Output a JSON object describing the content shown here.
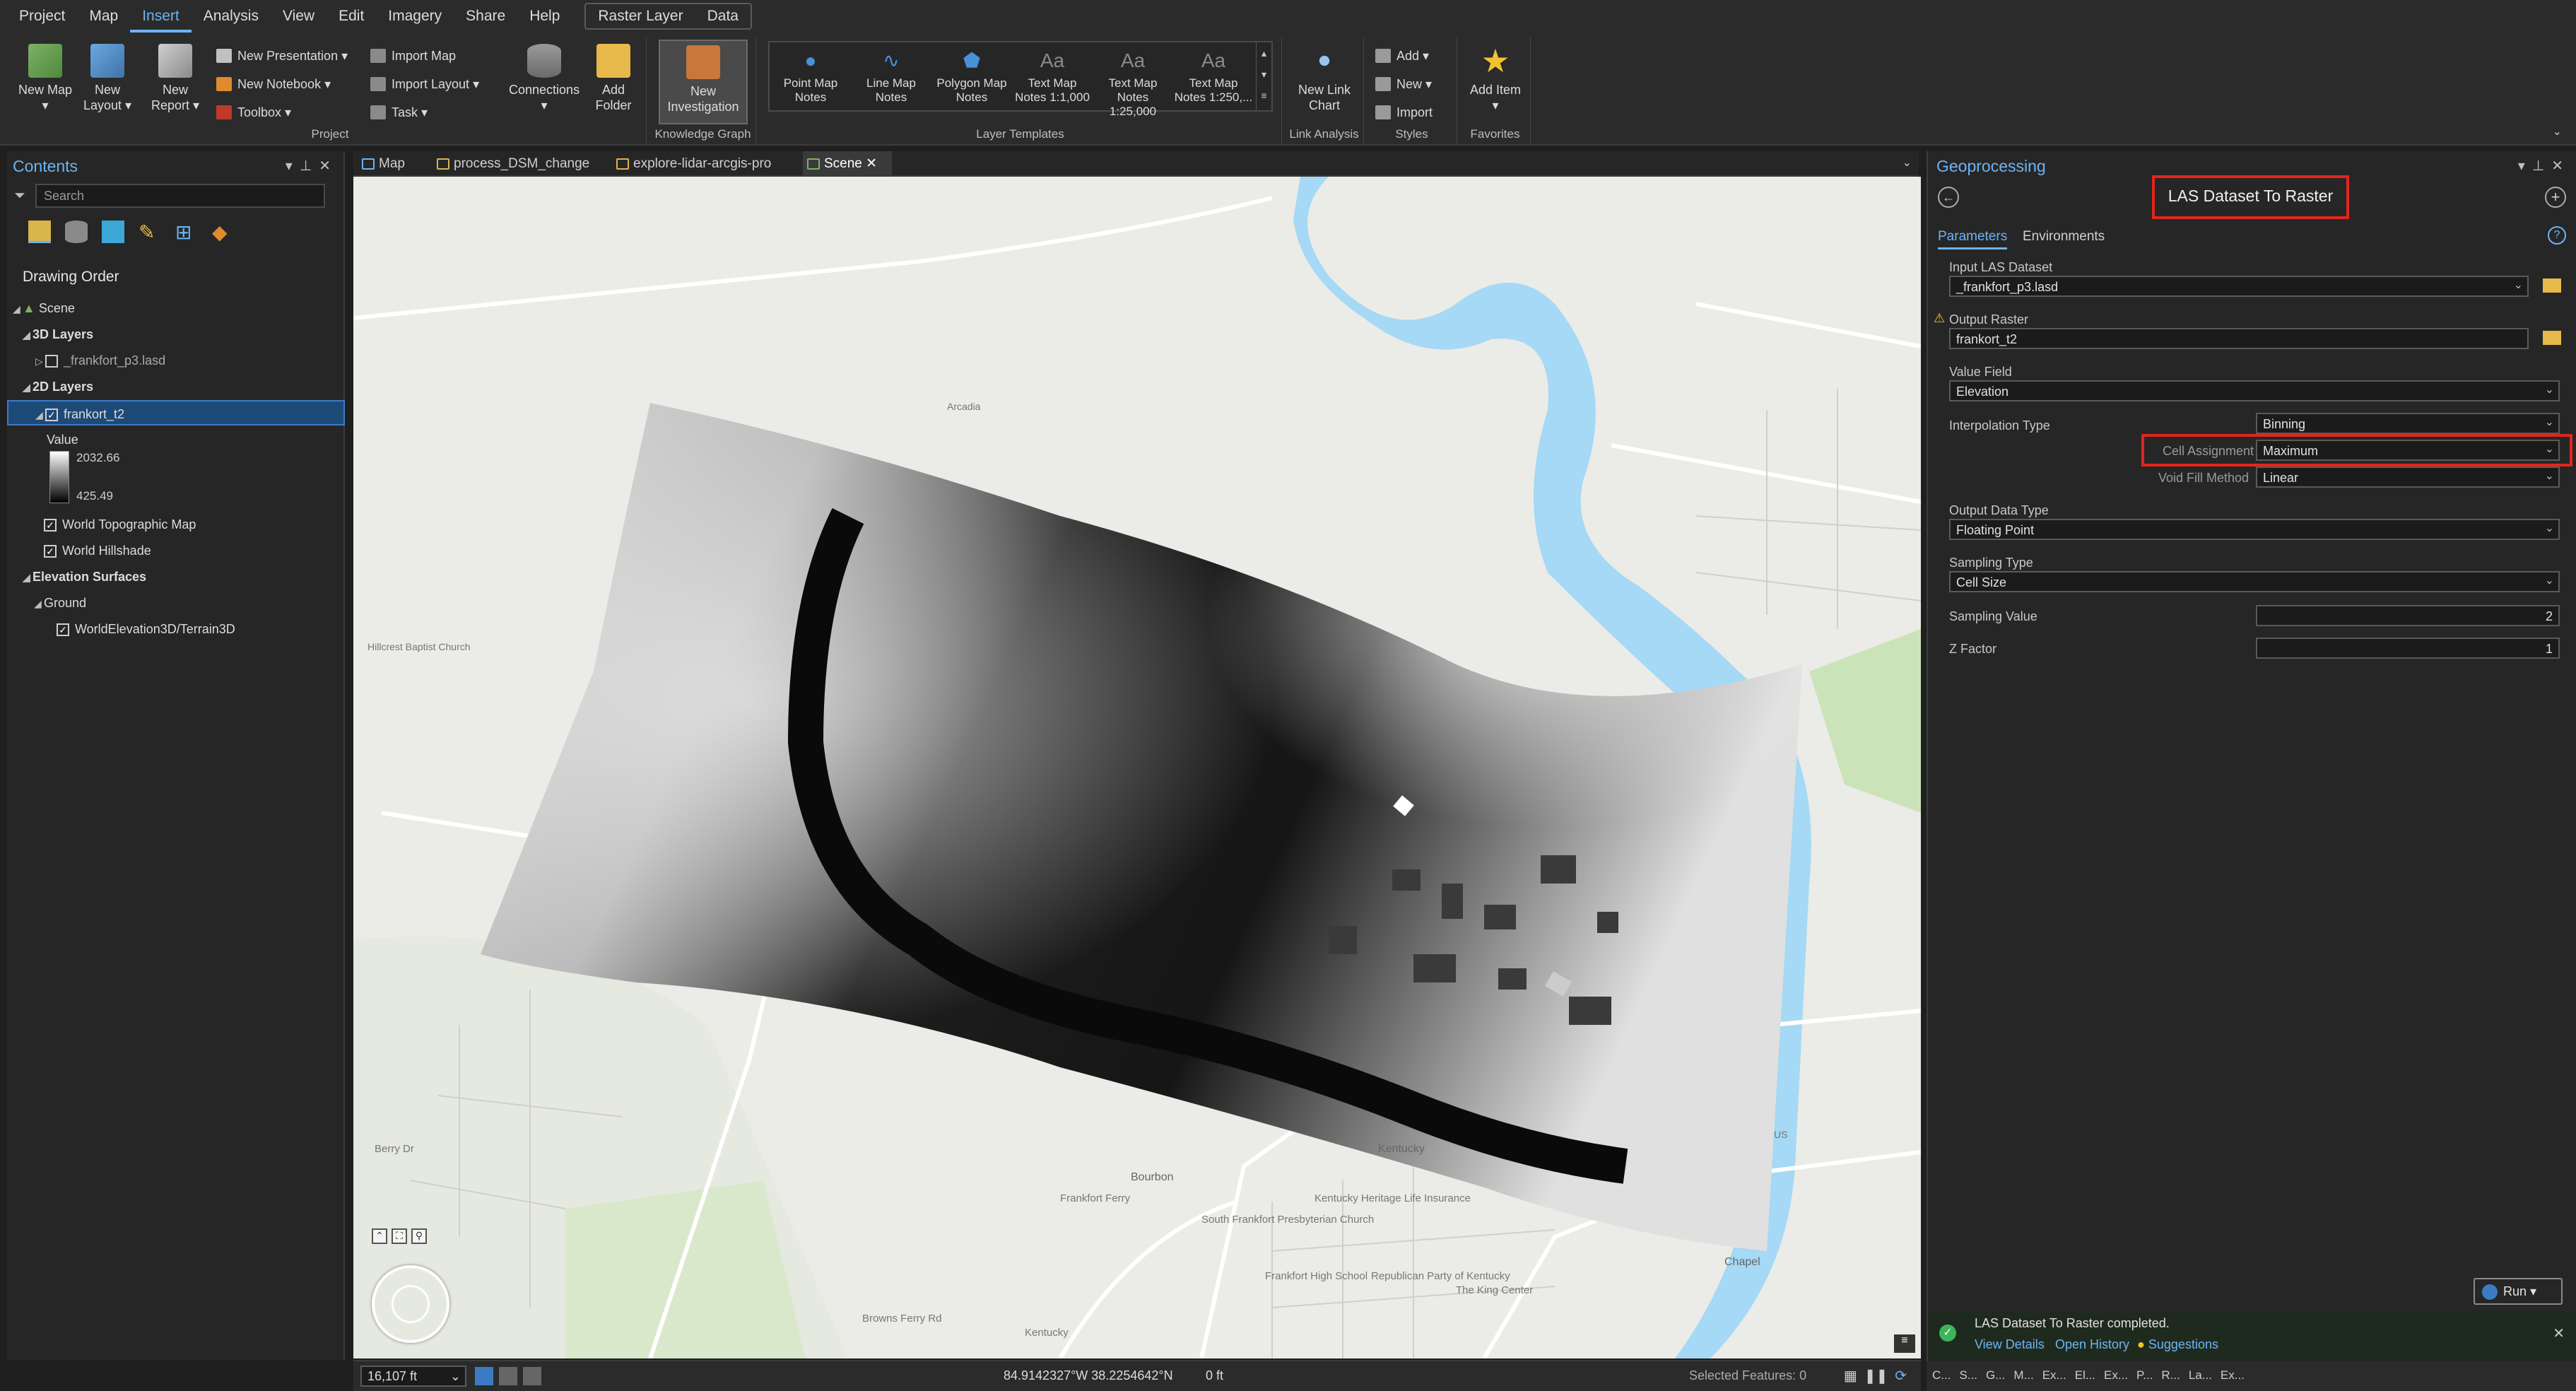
{
  "menubar": {
    "items": [
      "Project",
      "Map",
      "Insert",
      "Analysis",
      "View",
      "Edit",
      "Imagery",
      "Share",
      "Help"
    ],
    "active": "Insert",
    "contextual": [
      "Raster Layer",
      "Data"
    ]
  },
  "ribbon": {
    "project": {
      "label": "Project",
      "new_map": "New Map",
      "new_layout": "New Layout",
      "new_report": "New Report",
      "new_presentation": "New Presentation",
      "new_notebook": "New Notebook",
      "toolbox": "Toolbox",
      "import_map": "Import Map",
      "import_layout": "Import Layout",
      "task": "Task",
      "connections": "Connections",
      "add_folder": "Add Folder"
    },
    "knowledge_graph": {
      "label": "Knowledge Graph",
      "new_investigation": "New Investigation"
    },
    "layer_templates": {
      "label": "Layer Templates",
      "items": [
        "Point Map Notes",
        "Line Map Notes",
        "Polygon Map Notes",
        "Text Map Notes 1:1,000",
        "Text Map Notes 1:25,000",
        "Text Map Notes 1:250,..."
      ]
    },
    "link_analysis": {
      "label": "Link Analysis",
      "new_link_chart": "New Link Chart"
    },
    "styles": {
      "label": "Styles",
      "add": "Add",
      "new": "New",
      "import": "Import"
    },
    "favorites": {
      "label": "Favorites",
      "add_item": "Add Item"
    }
  },
  "contents": {
    "title": "Contents",
    "search_placeholder": "Search",
    "drawing_order": "Drawing Order",
    "tree": {
      "scene": "Scene",
      "layers3d": "3D Layers",
      "lasd": "_frankfort_p3.lasd",
      "layers2d": "2D Layers",
      "frankort_t2": "frankort_t2",
      "value_label": "Value",
      "value_high": "2032.66",
      "value_low": "425.49",
      "topo": "World Topographic Map",
      "hillshade": "World Hillshade",
      "elev_surfaces": "Elevation Surfaces",
      "ground": "Ground",
      "terrain": "WorldElevation3D/Terrain3D"
    }
  },
  "view_tabs": [
    "Map",
    "process_DSM_change",
    "explore-lidar-arcgis-pro",
    "Scene"
  ],
  "map_labels": {
    "l1": "Bourbon",
    "l2": "Kentucky",
    "l3": "Frankfort High School",
    "l4": "South Frankfort Presbyterian Church",
    "l5": "Kentucky Heritage Life Insurance",
    "l6": "Republican Party of Kentucky",
    "l7": "The King Center",
    "l8": "Chapel",
    "l9": "Berry Dr",
    "l10": "Browns Ferry Rd",
    "l11": "Frankfort Ferry",
    "l12": "Hillcrest Baptist Church",
    "l13": "Kentucky",
    "l14": "Arcadia",
    "l15": "US"
  },
  "statusbar": {
    "scale": "16,107 ft",
    "coords": "84.9142327°W 38.2254642°N",
    "elevation": "0 ft",
    "selected": "Selected Features: 0"
  },
  "geoprocessing": {
    "title": "Geoprocessing",
    "tool_name": "LAS Dataset To Raster",
    "tab_parameters": "Parameters",
    "tab_environments": "Environments",
    "params": {
      "input_las_label": "Input LAS Dataset",
      "input_las_value": "_frankfort_p3.lasd",
      "output_raster_label": "Output Raster",
      "output_raster_value": "frankort_t2",
      "value_field_label": "Value Field",
      "value_field_value": "Elevation",
      "interp_label": "Interpolation Type",
      "interp_value": "Binning",
      "cell_assign_label": "Cell Assignment",
      "cell_assign_value": "Maximum",
      "void_fill_label": "Void Fill Method",
      "void_fill_value": "Linear",
      "output_type_label": "Output Data Type",
      "output_type_value": "Floating Point",
      "sampling_type_label": "Sampling Type",
      "sampling_type_value": "Cell Size",
      "sampling_value_label": "Sampling Value",
      "sampling_value_value": "2",
      "zfactor_label": "Z Factor",
      "zfactor_value": "1"
    },
    "run": "Run",
    "completed": "LAS Dataset To Raster completed.",
    "view_details": "View Details",
    "open_history": "Open History",
    "suggestions": "Suggestions"
  },
  "taskbar": [
    "C...",
    "S...",
    "G...",
    "M...",
    "Ex...",
    "El...",
    "Ex...",
    "P...",
    "R...",
    "La...",
    "Ex..."
  ],
  "colors": {
    "accent": "#6cb4f3",
    "highlight_red": "#e0261d",
    "water": "#a5d9f5",
    "success": "#3cb55a"
  }
}
